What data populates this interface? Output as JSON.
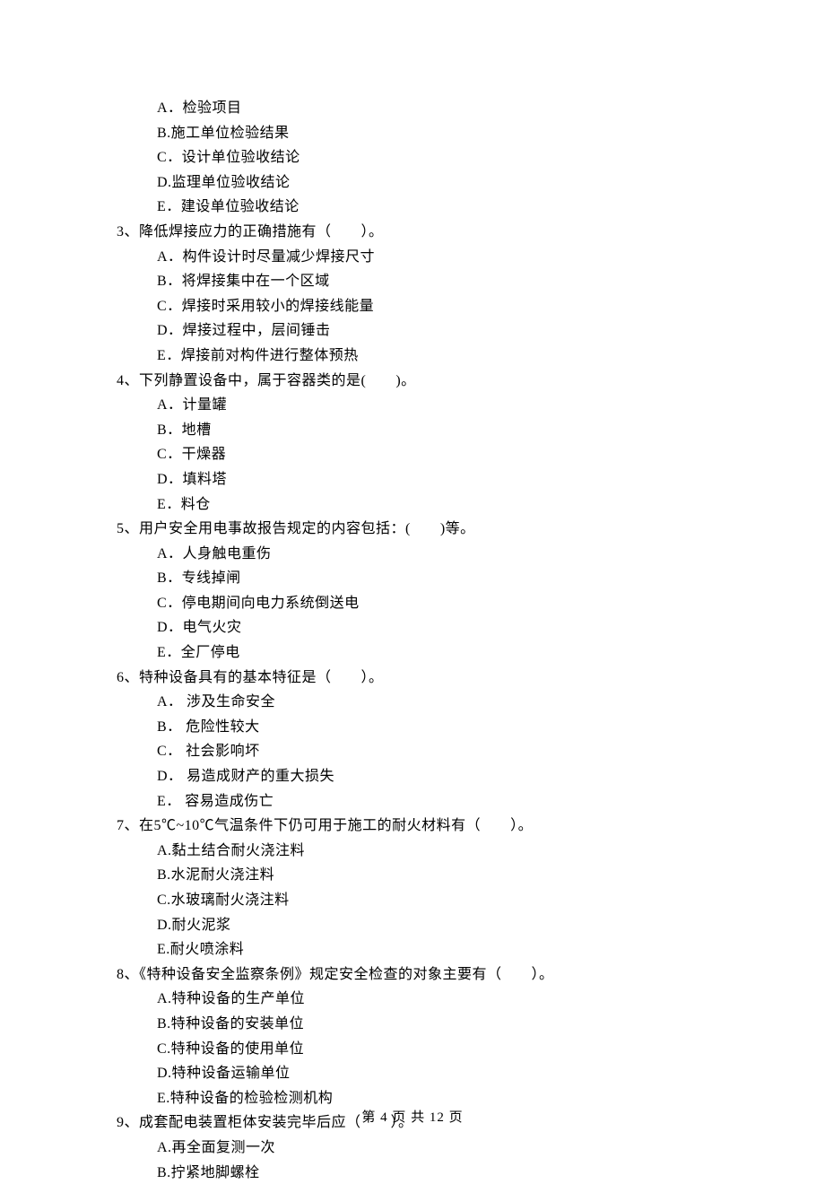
{
  "orphan_options": [
    "A．检验项目",
    "B.施工单位检验结果",
    "C．设计单位验收结论",
    "D.监理单位验收结论",
    "E．建设单位验收结论"
  ],
  "questions": [
    {
      "num": "3、",
      "text": "降低焊接应力的正确措施有（　　）。",
      "options": [
        "A．构件设计时尽量减少焊接尺寸",
        "B．将焊接集中在一个区域",
        "C．焊接时采用较小的焊接线能量",
        "D．焊接过程中，层间锤击",
        "E．焊接前对构件进行整体预热"
      ]
    },
    {
      "num": "4、",
      "text": "下列静置设备中，属于容器类的是(　　)。",
      "options": [
        "A．计量罐",
        "B．地槽",
        "C．干燥器",
        "D．填料塔",
        "E．料仓"
      ]
    },
    {
      "num": "5、",
      "text": "用户安全用电事故报告规定的内容包括：(　　)等。",
      "options": [
        "A．人身触电重伤",
        "B．专线掉闸",
        "C．停电期间向电力系统倒送电",
        "D．电气火灾",
        "E．全厂停电"
      ]
    },
    {
      "num": "6、",
      "text": "特种设备具有的基本特征是（　　）。",
      "options": [
        "A． 涉及生命安全",
        "B． 危险性较大",
        "C． 社会影响坏",
        "D． 易造成财产的重大损失",
        "E． 容易造成伤亡"
      ]
    },
    {
      "num": "7、",
      "text": "在5℃~10℃气温条件下仍可用于施工的耐火材料有（　　）。",
      "options": [
        "A.黏土结合耐火浇注料",
        "B.水泥耐火浇注料",
        "C.水玻璃耐火浇注料",
        "D.耐火泥浆",
        "E.耐火喷涂料"
      ]
    },
    {
      "num": "8、",
      "text": "《特种设备安全监察条例》规定安全检查的对象主要有（　　）。",
      "options": [
        "A.特种设备的生产单位",
        "B.特种设备的安装单位",
        "C.特种设备的使用单位",
        "D.特种设备运输单位",
        "E.特种设备的检验检测机构"
      ]
    },
    {
      "num": "9、",
      "text": "成套配电装置柜体安装完毕后应（　　）。",
      "options": [
        "A.再全面复测一次",
        "B.拧紧地脚螺栓"
      ]
    }
  ],
  "footer": "第 4 页 共 12 页"
}
